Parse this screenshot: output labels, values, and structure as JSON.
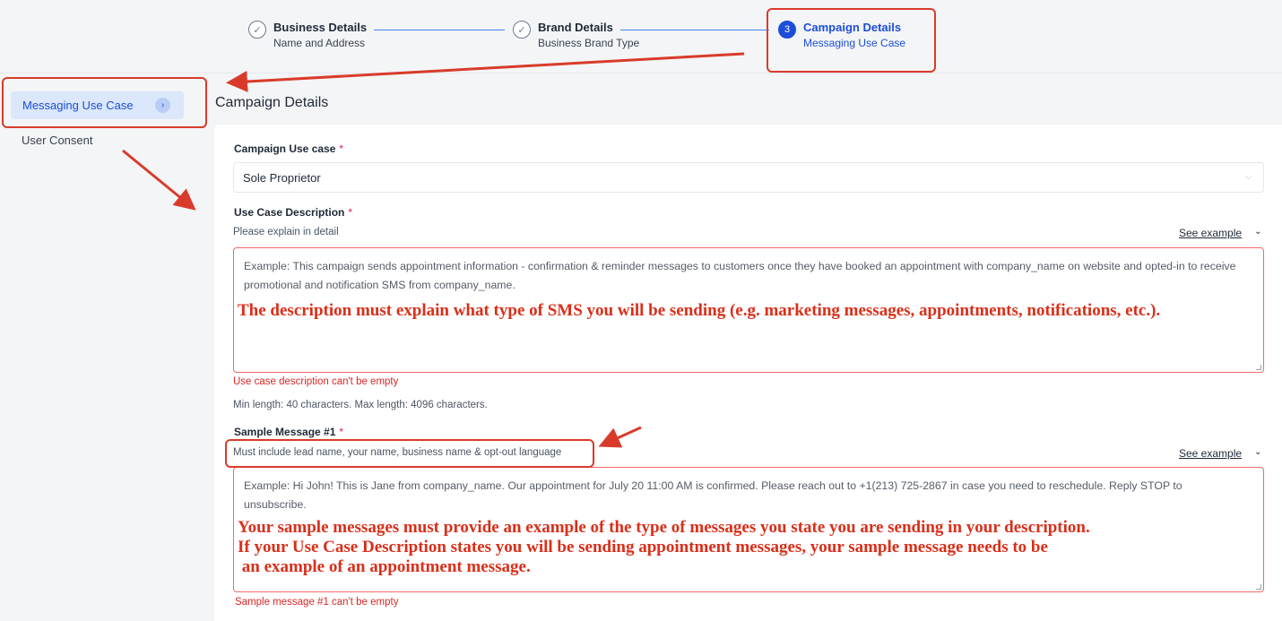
{
  "stepper": {
    "steps": [
      {
        "title": "Business Details",
        "subtitle": "Name and Address",
        "icon": "check-icon",
        "marker": "✓",
        "state": "done"
      },
      {
        "title": "Brand Details",
        "subtitle": "Business Brand Type",
        "icon": "check-icon",
        "marker": "✓",
        "state": "done"
      },
      {
        "title": "Campaign Details",
        "subtitle": "Messaging Use Case",
        "marker": "3",
        "state": "active"
      }
    ]
  },
  "sidebar": {
    "items": [
      {
        "label": "Messaging Use Case",
        "active": true,
        "icon": "chevron-right-icon",
        "glyph": "›"
      },
      {
        "label": "User Consent",
        "active": false
      }
    ]
  },
  "page": {
    "title": "Campaign Details"
  },
  "form": {
    "campaign_use_case": {
      "label": "Campaign Use case",
      "required_mark": "*",
      "value": "Sole Proprietor",
      "icon": "chevron-down-icon",
      "glyph": "⌵"
    },
    "use_case_description": {
      "label": "Use Case Description",
      "required_mark": "*",
      "hint": "Please explain in detail",
      "see_example": "See example",
      "see_example_icon": "chevron-down-icon",
      "see_example_glyph": "⌄",
      "placeholder": "Example: This campaign sends appointment information - confirmation & reminder messages to customers once they have booked an appointment with company_name on website and opted-in to receive promotional and notification SMS from company_name.",
      "annotation": "The description must explain what type of SMS you will be sending (e.g. marketing messages, appointments, notifications, etc.).",
      "error": "Use case description can't be empty",
      "length_hint": "Min length: 40 characters. Max length: 4096 characters."
    },
    "sample_message_1": {
      "label": "Sample Message #1",
      "required_mark": "*",
      "hint": "Must include lead name, your name, business name & opt-out language",
      "see_example": "See example",
      "see_example_icon": "chevron-down-icon",
      "see_example_glyph": "⌄",
      "placeholder": "Example: Hi John! This is Jane from company_name. Our appointment for July 20 11:00 AM is confirmed. Please reach out to +1(213) 725-2867 in case you need to reschedule. Reply STOP to unsubscribe.",
      "annotation_lines": [
        "Your sample messages must provide an example of the type of messages you state you are sending in your description.",
        "If your Use Case Description states you will be sending appointment messages, your sample message needs to be",
        " an example of an appointment message."
      ],
      "error": "Sample message #1 can't be empty"
    }
  },
  "colors": {
    "accent": "#1d4ed8",
    "annotation_red": "#d92f1a",
    "error_red": "#dc2626"
  }
}
